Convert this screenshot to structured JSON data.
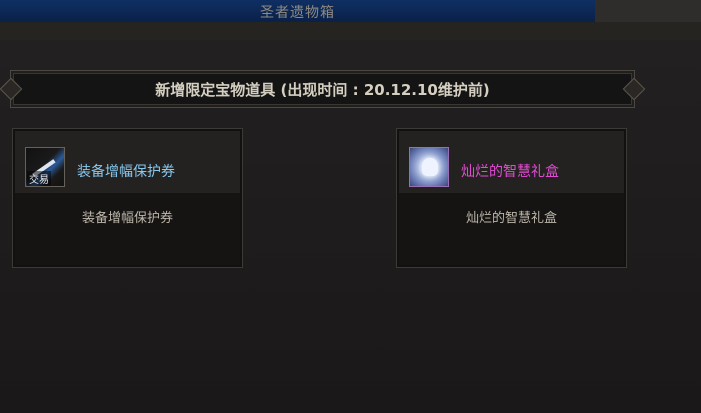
{
  "window": {
    "title": "圣者遗物箱"
  },
  "banner": {
    "text": "新增限定宝物道具 (出现时间 : 20.12.10维护前)"
  },
  "items": [
    {
      "name": "装备增幅保护券",
      "description": "装备增幅保护券",
      "icon": "scroll-icon",
      "tag": "交易",
      "name_color": "#87c8ef"
    },
    {
      "name": "灿烂的智慧礼盒",
      "description": "灿烂的智慧礼盒",
      "icon": "gift-box-icon",
      "name_color": "#e24bd4"
    }
  ]
}
